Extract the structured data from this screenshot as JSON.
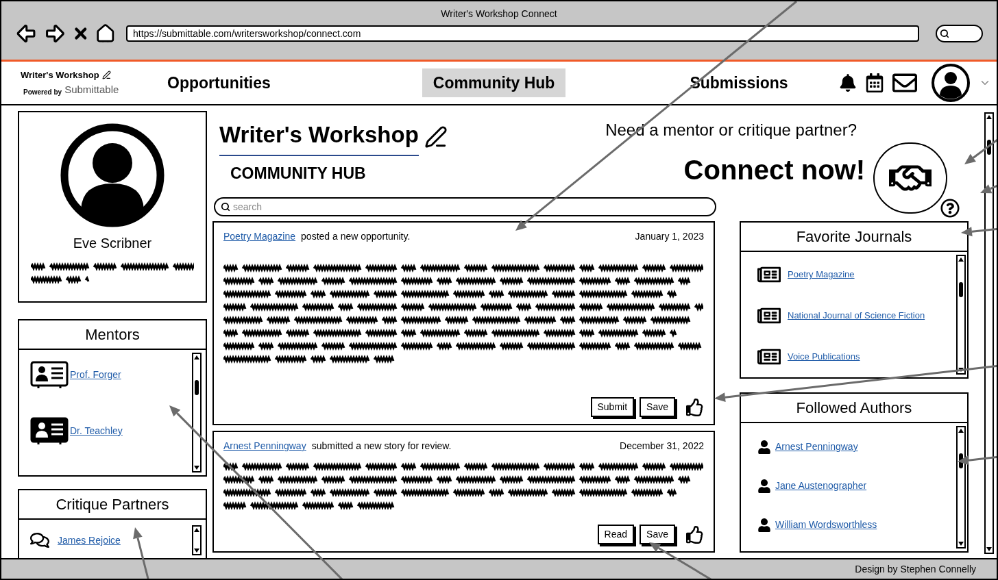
{
  "window": {
    "title": "Writer's Workshop Connect",
    "url": "https://submittable.com/writersworkshop/connect.com"
  },
  "header": {
    "logo_title": "Writer's Workshop",
    "powered_by": "Powered by",
    "brand": "Submittable",
    "tabs": [
      {
        "label": "Opportunities",
        "selected": false
      },
      {
        "label": "Community Hub",
        "selected": true
      },
      {
        "label": "Submissions",
        "selected": false
      }
    ]
  },
  "profile": {
    "name": "Eve Scribner"
  },
  "mentors": {
    "title": "Mentors",
    "items": [
      {
        "name": "Prof. Forger",
        "kind": "outline"
      },
      {
        "name": "Dr. Teachley",
        "kind": "filled"
      }
    ]
  },
  "critique_partners": {
    "title": "Critique Partners",
    "items": [
      {
        "name": "James Rejoice"
      }
    ]
  },
  "hub": {
    "title": "Writer's Workshop",
    "subtitle": "COMMUNITY HUB",
    "search_placeholder": "search"
  },
  "promo": {
    "question": "Need a mentor or critique partner?",
    "cta": "Connect now!"
  },
  "feed": [
    {
      "author": "Poetry Magazine",
      "action": "posted a new opportunity.",
      "date": "January 1, 2023",
      "buttons": [
        "Submit",
        "Save"
      ]
    },
    {
      "author": "Arnest Penningway",
      "action": "submitted a new story for review.",
      "date": "December 31, 2022",
      "buttons": [
        "Read",
        "Save"
      ]
    }
  ],
  "favorite_journals": {
    "title": "Favorite Journals",
    "items": [
      {
        "name": "Poetry Magazine"
      },
      {
        "name": "National Journal of Science Fiction"
      },
      {
        "name": "Voice Publications"
      }
    ]
  },
  "followed_authors": {
    "title": "Followed Authors",
    "items": [
      {
        "name": "Arnest Penningway"
      },
      {
        "name": "Jane Austenographer"
      },
      {
        "name": "William Wordsworthless"
      }
    ]
  },
  "footer": {
    "credit": "Design by Stephen Connelly"
  }
}
